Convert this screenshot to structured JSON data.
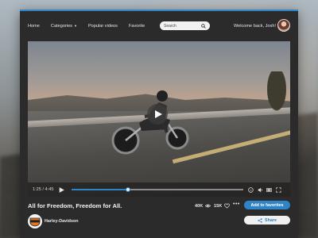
{
  "nav": {
    "links": [
      "Home",
      "Categories",
      "Popular videos",
      "Favorite"
    ],
    "search_placeholder": "Search",
    "welcome": "Welcome back, Josh!"
  },
  "player": {
    "time": "1:25 / 4:45",
    "progress": 0.33
  },
  "video": {
    "title": "All for Freedom, Freedom for All.",
    "views": "40K",
    "likes": "15K",
    "channel": "Harley-Davidson"
  },
  "actions": {
    "favorite_label": "Add to favorites",
    "share_label": "Share"
  },
  "colors": {
    "accent": "#2f84c8",
    "panel": "#2b2b2b"
  }
}
